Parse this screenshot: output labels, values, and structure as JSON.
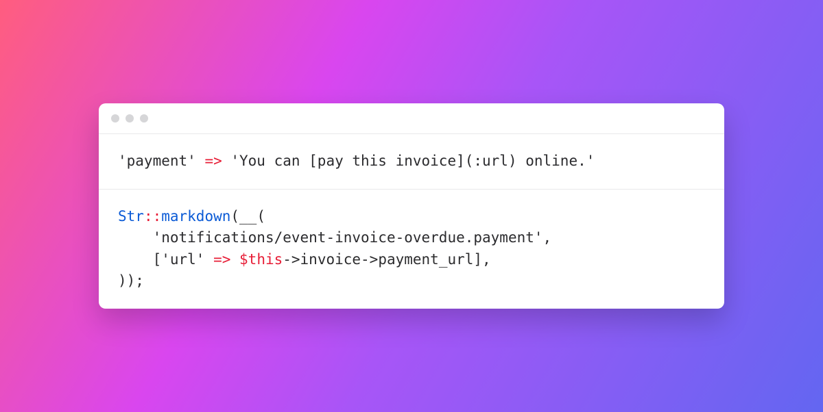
{
  "window": {
    "traffic_light_color": "#d6d6d8"
  },
  "code": {
    "block1": {
      "key": "'payment'",
      "arrow": " => ",
      "value": "'You can [pay this invoice](:url) online.'"
    },
    "block2": {
      "line1_class": "Str",
      "line1_scope": "::",
      "line1_func": "markdown",
      "line1_after": "(__(",
      "line2_indent": "    ",
      "line2_string": "'notifications/event-invoice-overdue.payment'",
      "line2_after": ",",
      "line3_indent": "    ",
      "line3_bracket_open": "[",
      "line3_key": "'url'",
      "line3_arrow": " => ",
      "line3_var": "$this",
      "line3_chain": "->invoice->payment_url",
      "line3_bracket_close": "],",
      "line4": "));"
    }
  }
}
